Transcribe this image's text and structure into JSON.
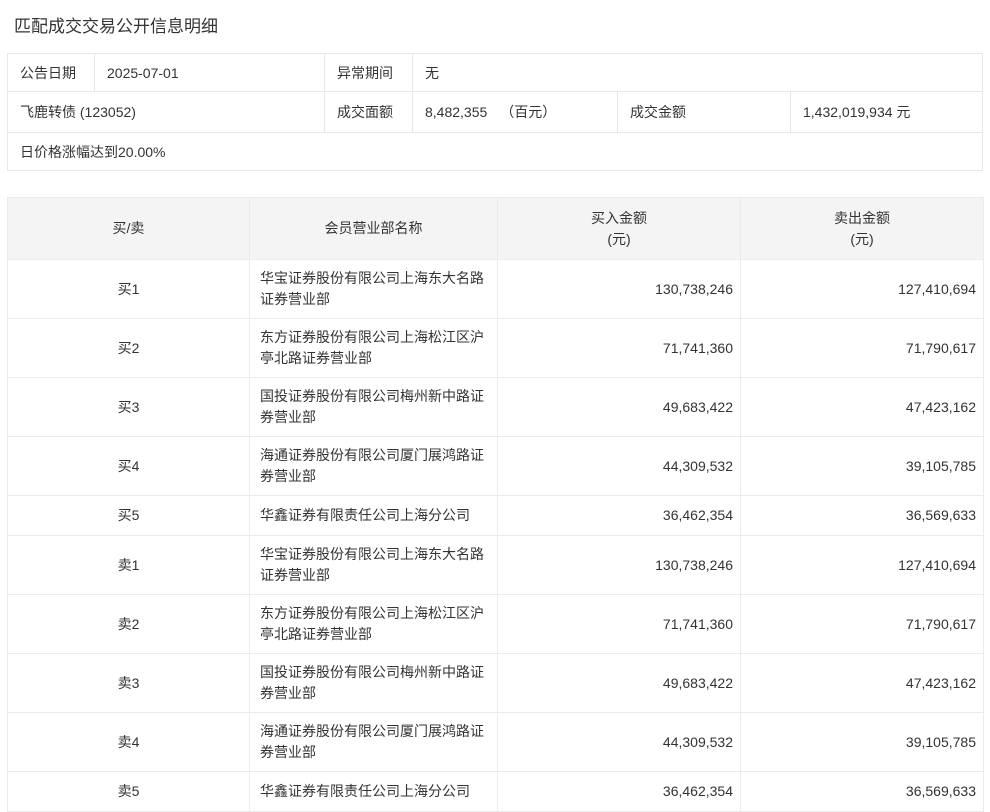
{
  "page": {
    "title": "匹配成交交易公开信息明细"
  },
  "summary": {
    "announce_date_label": "公告日期",
    "announce_date": "2025-07-01",
    "abnormal_period_label": "异常期间",
    "abnormal_period": "无",
    "security_name": "飞鹿转债 (123052)",
    "face_value_label": "成交面额",
    "face_value": "8,482,355",
    "face_value_unit": "（百元）",
    "turnover_label": "成交金额",
    "turnover": "1,432,019,934 元",
    "note": "日价格涨幅达到20.00%"
  },
  "table": {
    "headers": {
      "side": "买/卖",
      "branch": "会员营业部名称",
      "buy_line1": "买入金额",
      "buy_line2": "(元)",
      "sell_line1": "卖出金额",
      "sell_line2": "(元)"
    },
    "rows": [
      {
        "side": "买1",
        "branch": "华宝证券股份有限公司上海东大名路证券营业部",
        "buy": "130,738,246",
        "sell": "127,410,694"
      },
      {
        "side": "买2",
        "branch": "东方证券股份有限公司上海松江区沪亭北路证券营业部",
        "buy": "71,741,360",
        "sell": "71,790,617"
      },
      {
        "side": "买3",
        "branch": "国投证券股份有限公司梅州新中路证券营业部",
        "buy": "49,683,422",
        "sell": "47,423,162"
      },
      {
        "side": "买4",
        "branch": "海通证券股份有限公司厦门展鸿路证券营业部",
        "buy": "44,309,532",
        "sell": "39,105,785"
      },
      {
        "side": "买5",
        "branch": "华鑫证券有限责任公司上海分公司",
        "buy": "36,462,354",
        "sell": "36,569,633"
      },
      {
        "side": "卖1",
        "branch": "华宝证券股份有限公司上海东大名路证券营业部",
        "buy": "130,738,246",
        "sell": "127,410,694"
      },
      {
        "side": "卖2",
        "branch": "东方证券股份有限公司上海松江区沪亭北路证券营业部",
        "buy": "71,741,360",
        "sell": "71,790,617"
      },
      {
        "side": "卖3",
        "branch": "国投证券股份有限公司梅州新中路证券营业部",
        "buy": "49,683,422",
        "sell": "47,423,162"
      },
      {
        "side": "卖4",
        "branch": "海通证券股份有限公司厦门展鸿路证券营业部",
        "buy": "44,309,532",
        "sell": "39,105,785"
      },
      {
        "side": "卖5",
        "branch": "华鑫证券有限责任公司上海分公司",
        "buy": "36,462,354",
        "sell": "36,569,633"
      }
    ]
  },
  "colors": {
    "text": "#333333",
    "border": "#e8e8e8",
    "table_border": "#ebebeb",
    "table_header_bg": "#f4f4f4",
    "background": "#ffffff"
  }
}
